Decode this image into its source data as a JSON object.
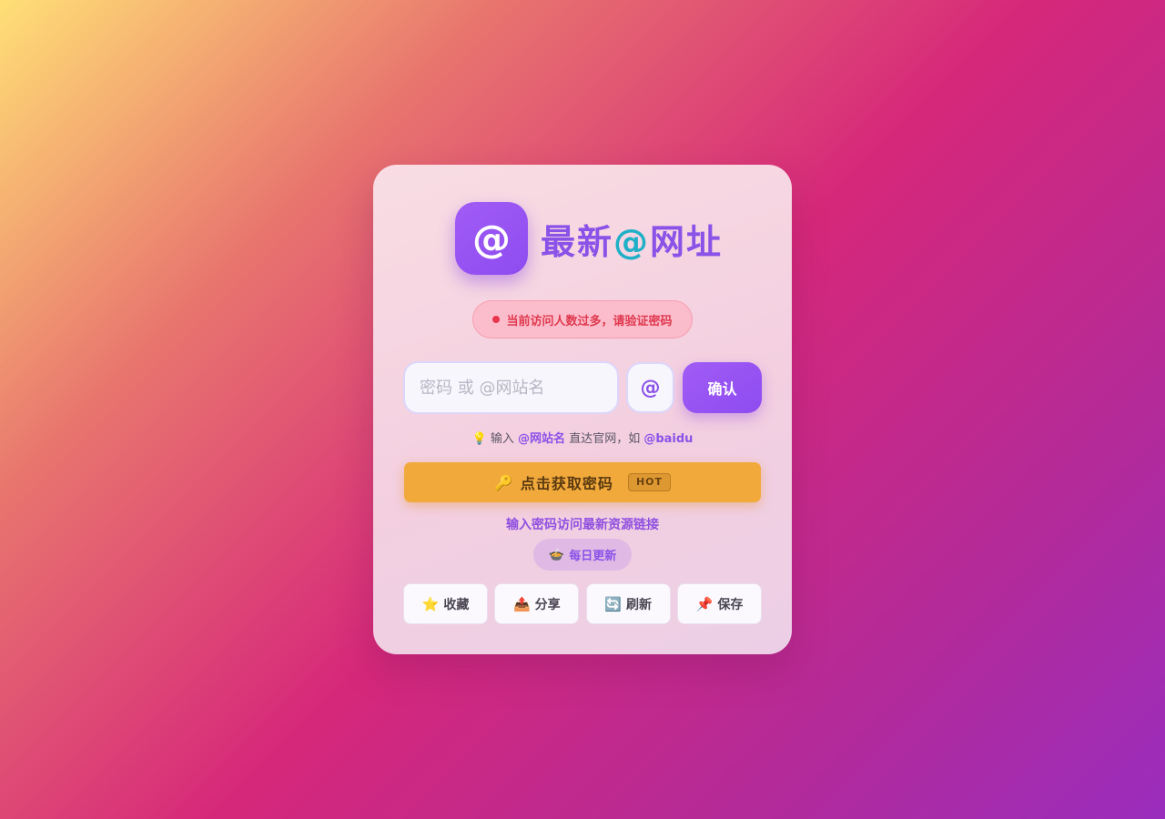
{
  "brand": {
    "logo_symbol": "@",
    "title_part1": "最新",
    "title_accent": "@",
    "title_part2": "网址"
  },
  "notice": {
    "text": "当前访问人数过多，请验证密码"
  },
  "login": {
    "placeholder": "密码 或 @网站名",
    "value": "",
    "at_button": "@",
    "confirm_button": "确认"
  },
  "hint": {
    "prefix_icon": "💡",
    "text1": "输入",
    "highlight1": "@网站名",
    "text2": "直达官网，如",
    "highlight2": "@baidu"
  },
  "get_password": {
    "icon": "🔑",
    "label": "点击获取密码",
    "badge": "HOT"
  },
  "tagline": "输入密码访问最新资源链接",
  "daily": {
    "icon": "🍲",
    "label": "每日更新"
  },
  "actions": [
    {
      "icon": "⭐",
      "label": "收藏"
    },
    {
      "icon": "📤",
      "label": "分享"
    },
    {
      "icon": "🔄",
      "label": "刷新"
    },
    {
      "icon": "📌",
      "label": "保存"
    }
  ],
  "colors": {
    "accent_purple": "#8b52e8",
    "accent_cyan": "#1fb0c8",
    "notice_red": "#e0394f",
    "hot_orange": "#f2a93b"
  }
}
